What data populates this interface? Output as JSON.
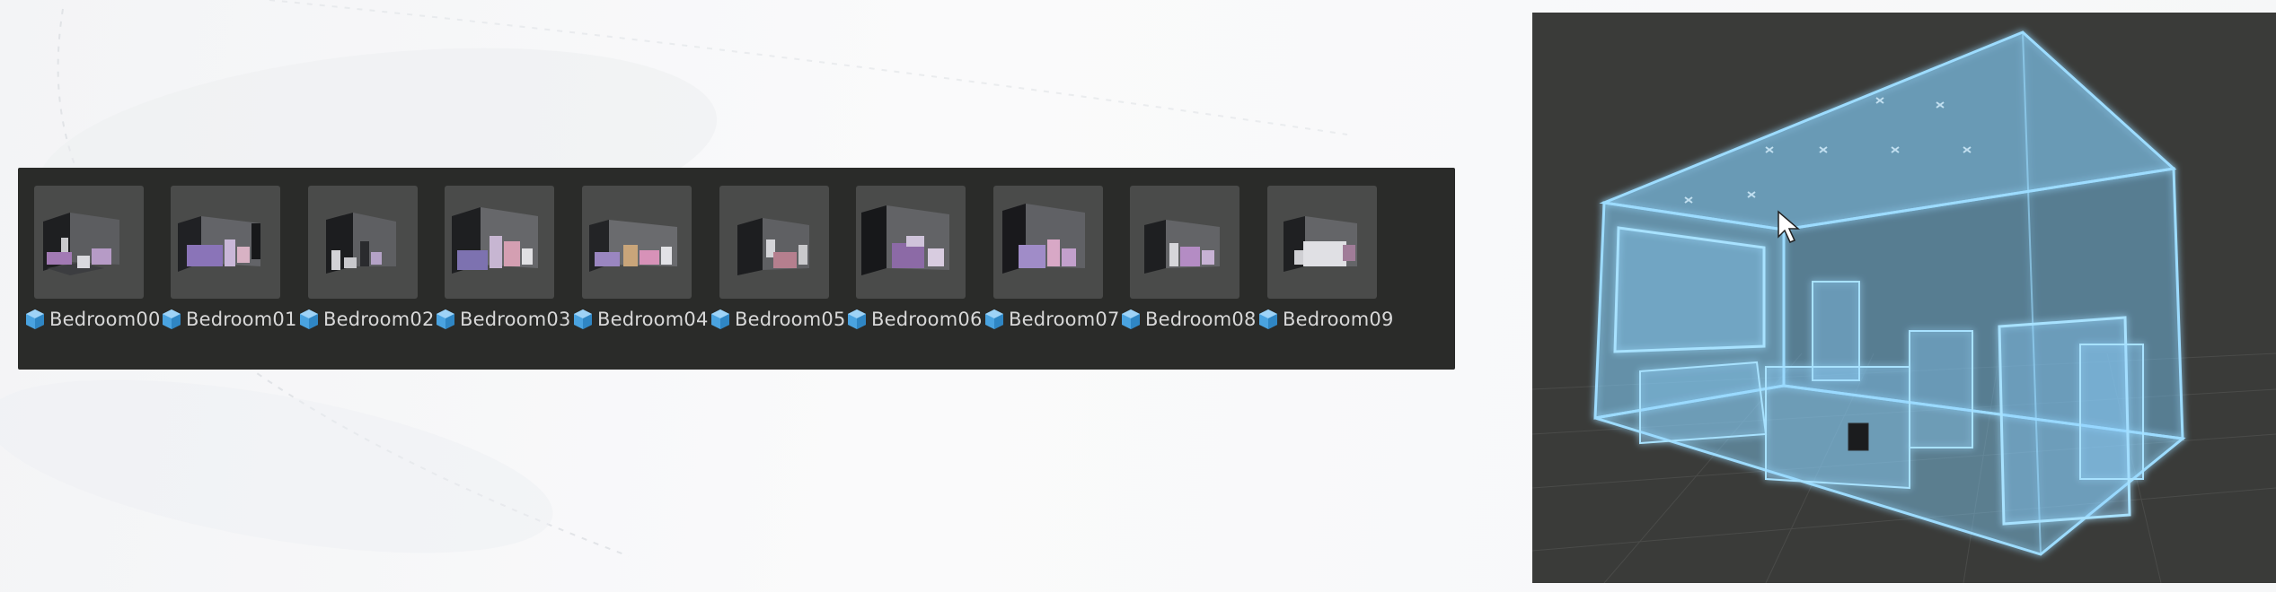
{
  "project_assets": {
    "items": [
      {
        "label": "Bedroom00",
        "icon": "prefab-icon"
      },
      {
        "label": "Bedroom01",
        "icon": "prefab-icon"
      },
      {
        "label": "Bedroom02",
        "icon": "prefab-icon"
      },
      {
        "label": "Bedroom03",
        "icon": "prefab-icon"
      },
      {
        "label": "Bedroom04",
        "icon": "prefab-icon"
      },
      {
        "label": "Bedroom05",
        "icon": "prefab-icon"
      },
      {
        "label": "Bedroom06",
        "icon": "prefab-icon"
      },
      {
        "label": "Bedroom07",
        "icon": "prefab-icon"
      },
      {
        "label": "Bedroom08",
        "icon": "prefab-icon"
      },
      {
        "label": "Bedroom09",
        "icon": "prefab-icon"
      }
    ]
  },
  "scene_view": {
    "content": "wireframe-room-bounding-volume",
    "accent_color": "#8fd3ff"
  }
}
